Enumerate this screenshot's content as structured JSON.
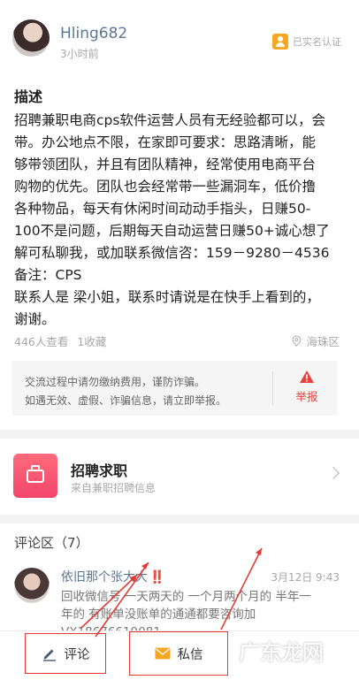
{
  "post": {
    "username": "Hling682",
    "time": "3小时前",
    "verified_label": "已实名认证",
    "section_title": "描述",
    "description_lines": [
      "招聘兼职电商cps软件运营人员有无经验都可以，会",
      "带。办公地点不限，在家即可要求：思路清晰，能",
      "够带领团队，并且有团队精神，经常使用电商平台",
      "购物的优先。团队也会经常带一些漏洞车，低价撸",
      "各种物品，每天有休闲时间动动手指头，日赚50-",
      "100不是问题，后期每天自动运营日赚50+诚心想了",
      "解可私聊我，或加联系微信咨：159－9280－4536",
      "备注：CPS",
      "联系人是 梁小姐，联系时请说是在快手上看到的，",
      "谢谢。"
    ],
    "views": "446人查看",
    "favorites": "1收藏",
    "location": "海珠区"
  },
  "warning": {
    "line1": "交流过程中请勿缴纳费用，谨防诈骗。",
    "line2": "如遇无效、虚假、诈骗信息，请立即举报。",
    "report_label": "举报"
  },
  "category": {
    "title": "招聘求职",
    "subtitle": "来自兼职招聘信息"
  },
  "comments": {
    "title": "评论区（7）",
    "items": [
      {
        "author": "依旧那个张大大",
        "emoji": "‼️",
        "time": "3月12日 9:43",
        "lines": [
          "回收微信号 一天两天的 一个月两个月的 半年一",
          "年的 有账单没账单的通通都要咨询加",
          "VX18676619081"
        ]
      }
    ]
  },
  "bottom_bar": {
    "comment_label": "评论",
    "message_label": "私信"
  },
  "watermark": "广东龙网",
  "colors": {
    "link": "#5c7796",
    "accent_red": "#e53935",
    "verified": "#f5a623",
    "job_icon": "#f0456a",
    "message_icon": "#f5a623"
  }
}
